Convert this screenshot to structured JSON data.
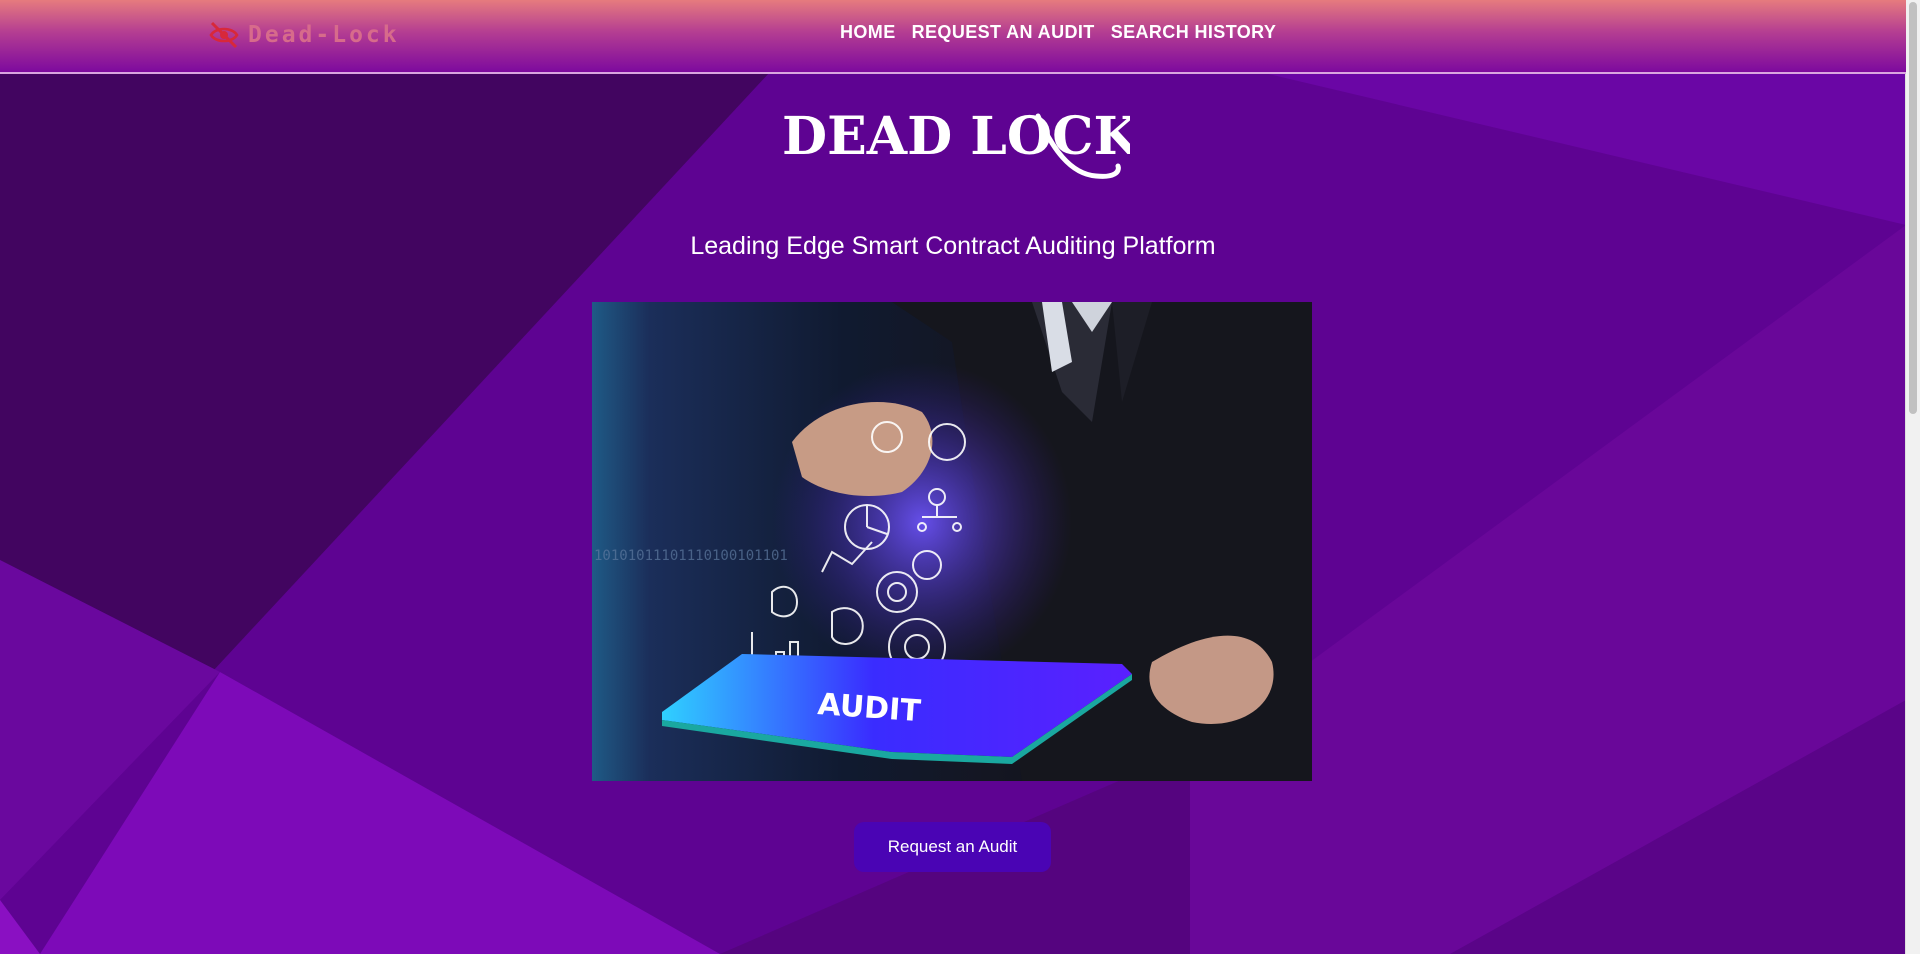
{
  "brand": {
    "name": "Dead-Lock",
    "icon": "eye-slash-icon"
  },
  "nav": {
    "items": [
      "HOME",
      "REQUEST AN AUDIT",
      "SEARCH HISTORY"
    ]
  },
  "hero": {
    "logo_text": "DEAD LOCK",
    "tagline": "Leading Edge Smart Contract Auditing Platform",
    "image_text": "AUDIT",
    "binary_text": "10101011101110100101101",
    "cta_label": "Request an Audit"
  },
  "colors": {
    "background": "#4e0278",
    "nav_gradient_top": "#e67b7e",
    "nav_gradient_bottom": "#7d0a9e",
    "brand_text": "#d76b8b",
    "cta": "#4a04b4"
  }
}
